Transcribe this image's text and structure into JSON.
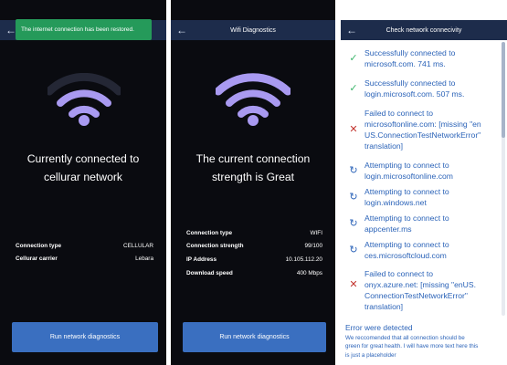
{
  "screen1": {
    "toast": "The internet connection has been restored.",
    "headline_line1": "Currently connected to",
    "headline_line2": "cellurar network",
    "details": [
      {
        "label": "Connection type",
        "value": "CELLULAR"
      },
      {
        "label": "Cellurar carrier",
        "value": "Lebara"
      }
    ],
    "run_button": "Run network diagnostics"
  },
  "screen2": {
    "title": "Wifi Diagnostics",
    "headline_line1": "The current connection",
    "headline_line2": "strength is Great",
    "details": [
      {
        "label": "Connection type",
        "value": "WIFI"
      },
      {
        "label": "Connection strength",
        "value": "99/100"
      },
      {
        "label": "IP Address",
        "value": "10.105.112.20"
      },
      {
        "label": "Download speed",
        "value": "400 Mbps"
      }
    ],
    "run_button": "Run network diagnostics"
  },
  "screen3": {
    "title": "Check network connecivity",
    "items": [
      {
        "status": "success",
        "line1": "Successfully connected to",
        "line2": "microsoft.com. 741 ms.",
        "line3": "",
        "line4": ""
      },
      {
        "status": "success",
        "line1": "Successfully connected to",
        "line2": "login.microsoft.com. 507 ms.",
        "line3": "",
        "line4": ""
      },
      {
        "status": "failed",
        "line1": "Failed to connect to",
        "line2": "microsoftonline.com: [missing \"en",
        "line3": "US.ConnectionTestNetworkError\"",
        "line4": "translation]"
      },
      {
        "status": "pending",
        "line1": "Attempting to connect to",
        "line2": "login.microsoftonline.com",
        "line3": "",
        "line4": ""
      },
      {
        "status": "pending",
        "line1": "Attempting to connect to",
        "line2": "login.windows.net",
        "line3": "",
        "line4": ""
      },
      {
        "status": "pending",
        "line1": "Attempting to connect to",
        "line2": "appcenter.ms",
        "line3": "",
        "line4": ""
      },
      {
        "status": "pending",
        "line1": "Attempting to connect to",
        "line2": "ces.microsoftcloud.com",
        "line3": "",
        "line4": ""
      },
      {
        "status": "failed",
        "line1": "Failed to connect to",
        "line2": "onyx.azure.net: [missing \"enUS.",
        "line3": "ConnectionTestNetworkError\"",
        "line4": "translation]"
      }
    ],
    "error_title": "Error were detected",
    "error_body_line1": "We reccomended that all connection should be",
    "error_body_line2": "green for great health. I will have more text here this",
    "error_body_line3": "is just a placeholder"
  },
  "colors": {
    "wifi": "#a99af1",
    "wifi_dim": "#242735",
    "header": "#1d2c4b",
    "toast": "#259a5a",
    "button": "#3a6fc0",
    "link": "#2b63b8",
    "success": "#3bb56b",
    "fail": "#c3352f"
  }
}
